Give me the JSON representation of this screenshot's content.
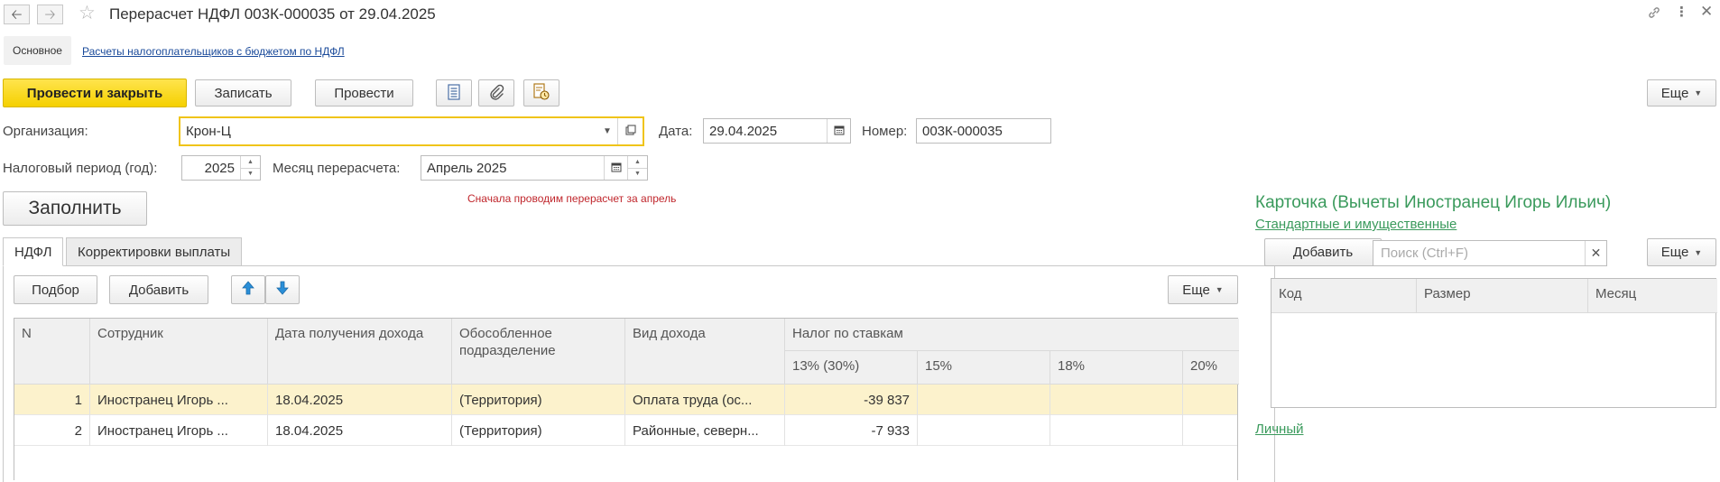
{
  "window": {
    "title": "Перерасчет НДФЛ 003К-000035 от 29.04.2025"
  },
  "sections": {
    "main": "Основное",
    "link": "Расчеты налогоплательщиков с бюджетом по НДФЛ"
  },
  "toolbar": {
    "post_close": "Провести и закрыть",
    "save": "Записать",
    "post": "Провести",
    "more": "Еще"
  },
  "form": {
    "org_label": "Организация:",
    "org_value": "Крон-Ц",
    "date_label": "Дата:",
    "date_value": "29.04.2025",
    "number_label": "Номер:",
    "number_value": "003К-000035",
    "period_label": "Налоговый период (год):",
    "period_value": "2025",
    "month_label": "Месяц перерасчета:",
    "month_value": "Апрель 2025",
    "fill_button": "Заполнить",
    "note": "Сначала проводим перерасчет за апрель"
  },
  "tabs": [
    {
      "label": "НДФЛ",
      "active": true
    },
    {
      "label": "Корректировки выплаты",
      "active": false
    }
  ],
  "table_toolbar": {
    "pick": "Подбор",
    "add": "Добавить",
    "more": "Еще"
  },
  "table": {
    "headers": {
      "n": "N",
      "employee": "Сотрудник",
      "income_date": "Дата получения дохода",
      "division": "Обособленное подразделение",
      "income_type": "Вид дохода",
      "tax_group": "Налог по ставкам",
      "rate1": "13% (30%)",
      "rate2": "15%",
      "rate3": "18%",
      "rate4": "20%"
    },
    "rows": [
      {
        "n": "1",
        "employee": "Иностранец Игорь ...",
        "date": "18.04.2025",
        "division": "(Территория)",
        "income_type": "Оплата труда (ос...",
        "rate1": "-39 837",
        "rate2": "",
        "rate3": "",
        "rate4": "",
        "selected": true
      },
      {
        "n": "2",
        "employee": "Иностранец Игорь ...",
        "date": "18.04.2025",
        "division": "(Территория)",
        "income_type": "Районные, северн...",
        "rate1": "-7 933",
        "rate2": "",
        "rate3": "",
        "rate4": "",
        "selected": false
      }
    ]
  },
  "card": {
    "title": "Карточка (Вычеты Иностранец Игорь Ильич)",
    "link_standard": "Стандартные и имущественные",
    "add": "Добавить",
    "search_placeholder": "Поиск (Ctrl+F)",
    "more": "Еще",
    "headers": {
      "code": "Код",
      "size": "Размер",
      "month": "Месяц"
    },
    "link_personal": "Личный"
  },
  "colors": {
    "primary_button": "#f5d000",
    "selected_row": "#fcf2cc",
    "card_green": "#3a9a5c",
    "note_red": "#c0262c",
    "link_blue": "#1a4a9a"
  },
  "icons": [
    "back-arrow-icon",
    "forward-arrow-icon",
    "star-icon",
    "link-icon",
    "kebab-menu-icon",
    "close-icon",
    "document-list-icon",
    "paperclip-icon",
    "document-clock-icon",
    "dropdown-arrow-icon",
    "open-icon",
    "calendar-icon",
    "arrow-up-icon",
    "arrow-down-icon",
    "clear-icon"
  ]
}
